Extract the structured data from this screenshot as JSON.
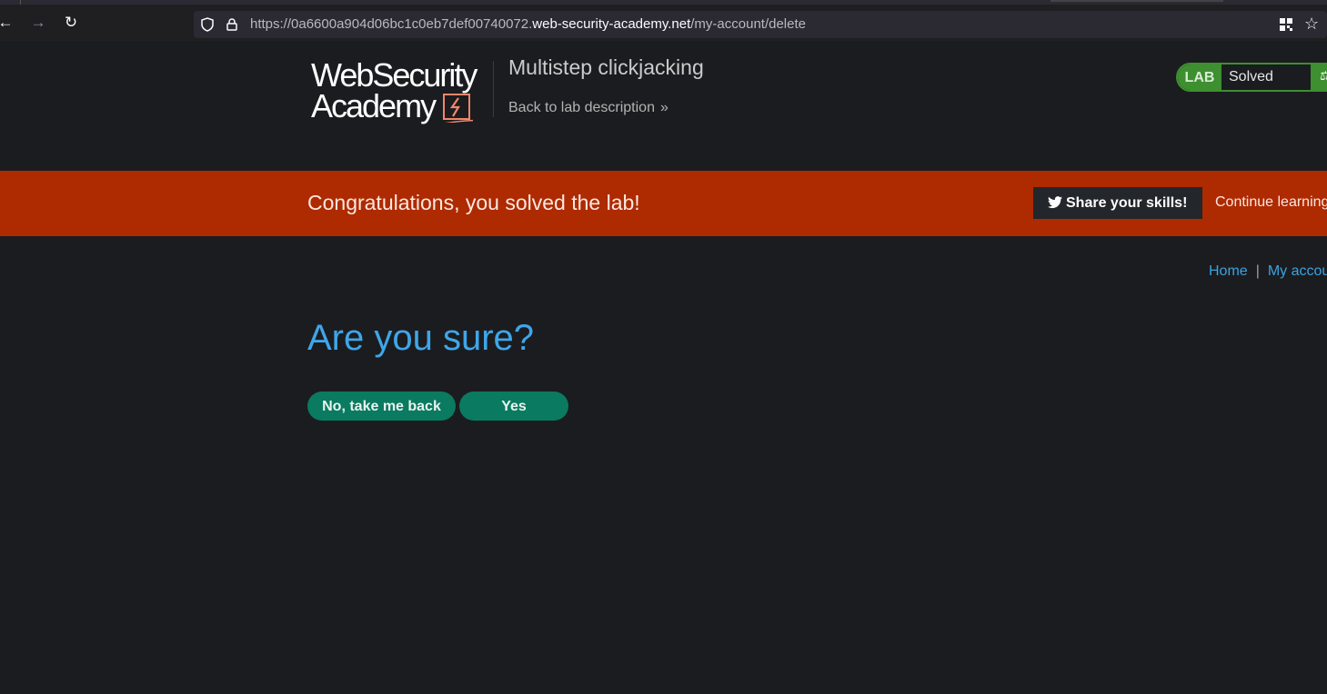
{
  "browser": {
    "url_prefix": "https://0a6600a904d06bc1c0eb7def00740072.",
    "url_host": "web-security-academy.net",
    "url_path": "/my-account/delete"
  },
  "header": {
    "logo_line1": "WebSecurity",
    "logo_line2": "Academy",
    "lab_title": "Multistep clickjacking",
    "back_link": "Back to lab description",
    "lab_badge": "LAB",
    "lab_status": "Solved"
  },
  "banner": {
    "message": "Congratulations, you solved the lab!",
    "share_button": "Share your skills!",
    "continue_link": "Continue learning"
  },
  "nav": {
    "home": "Home",
    "separator": "|",
    "my_account": "My account"
  },
  "main": {
    "heading": "Are you sure?",
    "no_button": "No, take me back",
    "yes_button": "Yes"
  },
  "colors": {
    "page_bg": "#1b1c1f",
    "banner_bg": "#ae2a00",
    "accent_blue": "#3ea6e9",
    "button_green": "#0a7a60",
    "lab_green": "#3d8f2f"
  },
  "icons": [
    "back-arrow-icon",
    "forward-arrow-icon",
    "reload-icon",
    "shield-icon",
    "lock-icon",
    "qr-code-icon",
    "bookmark-star-icon",
    "bolt-icon",
    "chevron-double-right-icon",
    "flask-icon",
    "twitter-icon"
  ]
}
